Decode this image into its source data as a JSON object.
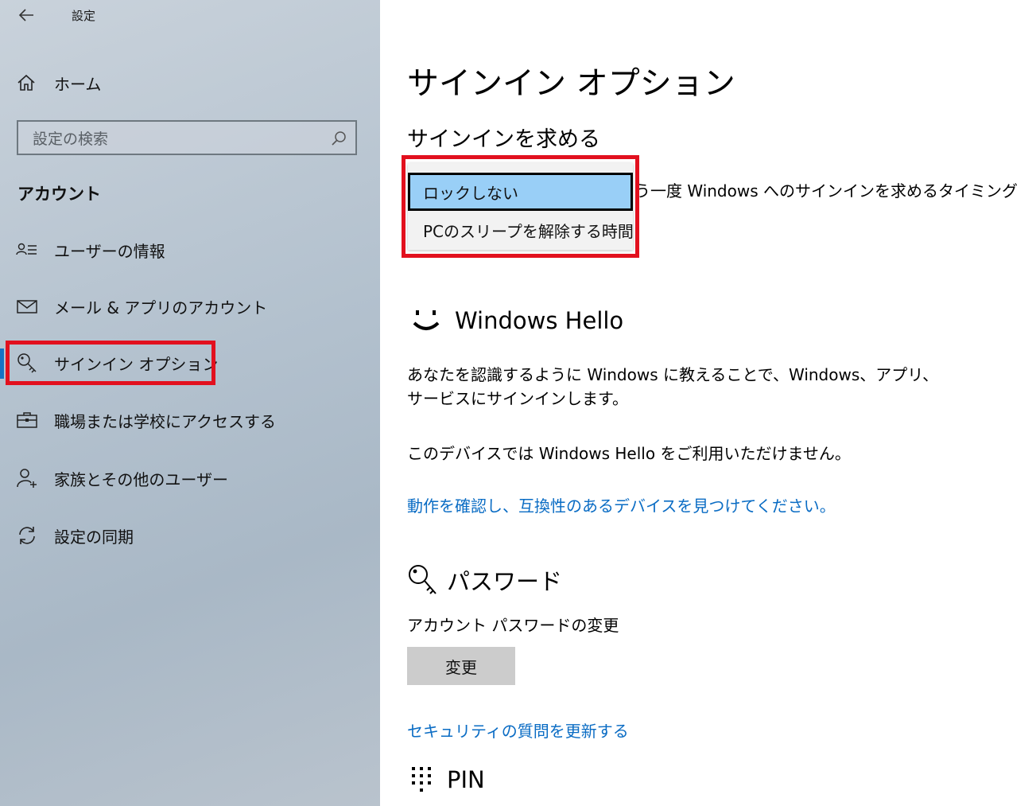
{
  "window": {
    "title": "設定"
  },
  "sidebar": {
    "home_label": "ホーム",
    "search_placeholder": "設定の検索",
    "section_heading": "アカウント",
    "items": [
      {
        "label": "ユーザーの情報",
        "icon": "user-info-icon"
      },
      {
        "label": "メール & アプリのアカウント",
        "icon": "mail-icon"
      },
      {
        "label": "サインイン オプション",
        "icon": "key-icon",
        "active": true
      },
      {
        "label": "職場または学校にアクセスする",
        "icon": "briefcase-icon"
      },
      {
        "label": "家族とその他のユーザー",
        "icon": "add-person-icon"
      },
      {
        "label": "設定の同期",
        "icon": "sync-icon"
      }
    ]
  },
  "main": {
    "title": "サインイン オプション",
    "require_signin": {
      "heading": "サインインを求める",
      "description_partial": "う一度 Windows へのサインインを求めるタイミング",
      "dropdown_options": [
        "ロックしない",
        "PCのスリープを解除する時間"
      ],
      "selected_option": "ロックしない"
    },
    "windows_hello": {
      "heading": "Windows Hello",
      "description": "あなたを認識するように Windows に教えることで、Windows、アプリ、サービスにサインインします。",
      "unavailable": "このデバイスでは Windows Hello をご利用いただけません。",
      "link": "動作を確認し、互換性のあるデバイスを見つけてください。"
    },
    "password": {
      "heading": "パスワード",
      "label": "アカウント パスワードの変更",
      "button": "変更",
      "security_link": "セキュリティの質問を更新する"
    },
    "pin": {
      "heading": "PIN"
    }
  },
  "colors": {
    "accent": "#1673c4",
    "link": "#0a6cc4",
    "highlight_box": "#e2101e",
    "selected_option_bg": "#99cff7",
    "button_bg": "#cccccc"
  }
}
